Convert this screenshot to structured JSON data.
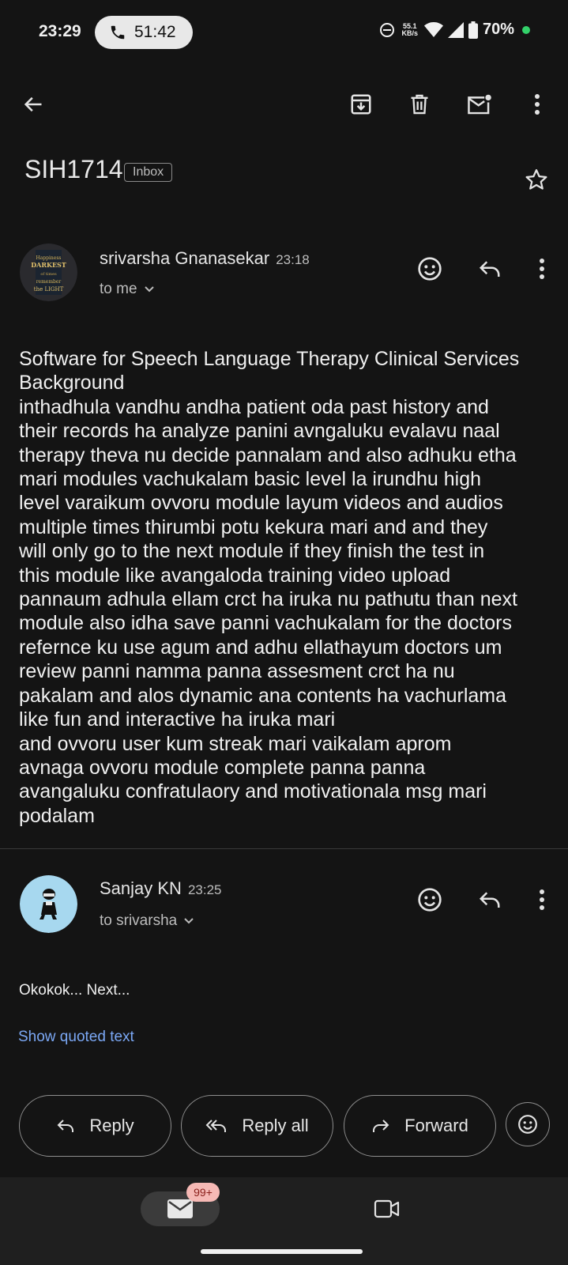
{
  "status_bar": {
    "time": "23:29",
    "call_duration": "51:42",
    "net_speed_value": "55.1",
    "net_speed_unit": "KB/s",
    "battery": "70%",
    "icons": [
      "dnd-icon",
      "wifi-icon",
      "signal-icon",
      "battery-icon",
      "charging-dot"
    ]
  },
  "toolbar": {
    "icons": [
      "back-arrow-icon",
      "archive-icon",
      "trash-icon",
      "mark-unread-icon",
      "more-vert-icon"
    ]
  },
  "subject": {
    "title": "SIH1714",
    "label": "Inbox"
  },
  "messages": [
    {
      "sender": "srivarsha Gnanasekar",
      "time": "23:18",
      "recipient": "to me",
      "body": "Software for Speech Language Therapy Clinical Services\nBackground\ninthadhula vandhu andha patient oda past history and\ntheir records ha analyze panini avngaluku evalavu naal\ntherapy theva nu decide pannalam and also adhuku etha\nmari modules vachukalam basic level la irundhu high\nlevel varaikum ovvoru module layum videos and audios\nmultiple times thirumbi potu kekura mari and and they\nwill only go to the next module if they finish the test in\nthis module like avangaloda training video upload\npannaum adhula ellam crct ha iruka nu pathutu than next\nmodule also idha save panni vachukalam for the doctors\nrefernce ku use agum and adhu ellathayum doctors um\nreview panni namma panna assesment crct ha nu\npakalam and alos dynamic ana contents ha vachurlama\nlike fun and interactive ha iruka mari\nand ovvoru user kum streak mari vaikalam aprom\navnaga ovvoru module complete panna panna\navangaluku confratulaory and motivationala msg mari\npodalam"
    },
    {
      "sender": "Sanjay KN",
      "time": "23:25",
      "recipient": "to srivarsha",
      "body": "Okokok... Next..."
    }
  ],
  "show_quoted_text": "Show quoted text",
  "actions": {
    "reply": "Reply",
    "reply_all": "Reply all",
    "forward": "Forward"
  },
  "bottom_nav": {
    "mail_badge": "99+"
  },
  "colors": {
    "background": "#141414",
    "link": "#7ba8f5",
    "badge_bg": "#f6b9b5",
    "charging_dot": "#33d16a"
  }
}
